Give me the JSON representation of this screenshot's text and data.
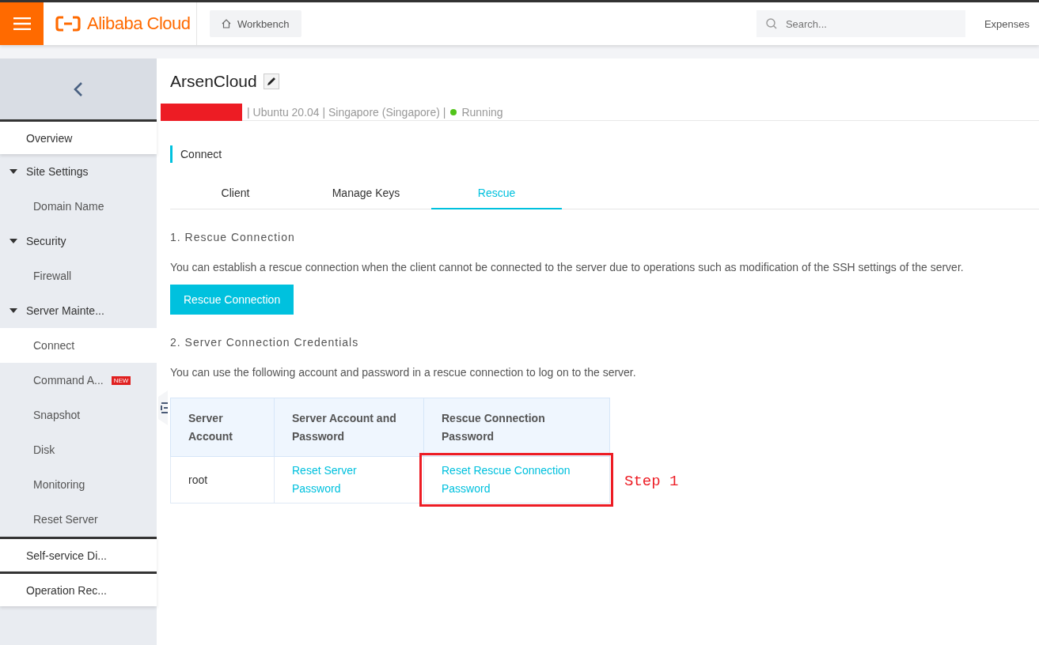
{
  "topbar": {
    "brand": "Alibaba Cloud",
    "workbench": "Workbench",
    "search": {
      "placeholder": "Search..."
    },
    "links": [
      "Expenses"
    ]
  },
  "sidebar": {
    "items": [
      {
        "label": "Overview",
        "kind": "top"
      },
      {
        "label": "Site Settings",
        "kind": "group",
        "expanded": true,
        "selected": false,
        "children": [
          {
            "label": "Domain Name",
            "selected": false
          }
        ]
      },
      {
        "label": "Security",
        "kind": "group",
        "expanded": true,
        "selected": false,
        "children": [
          {
            "label": "Firewall",
            "selected": false
          }
        ]
      },
      {
        "label": "Server Mainte...",
        "kind": "group",
        "expanded": true,
        "selected": false,
        "children": [
          {
            "label": "Connect",
            "selected": true
          },
          {
            "label": "Command A...",
            "selected": false,
            "badge": "NEW"
          },
          {
            "label": "Snapshot",
            "selected": false
          },
          {
            "label": "Disk",
            "selected": false
          },
          {
            "label": "Monitoring",
            "selected": false
          },
          {
            "label": "Reset Server",
            "selected": false
          }
        ]
      },
      {
        "label": "Self-service Di...",
        "kind": "top"
      },
      {
        "label": "Operation Rec...",
        "kind": "top"
      }
    ]
  },
  "header": {
    "title": "ArsenCloud",
    "redacted": true,
    "meta": "| Ubuntu 20.04 | Singapore (Singapore) |",
    "status": {
      "label": "Running",
      "color": "#52c41a"
    }
  },
  "section": {
    "title": "Connect"
  },
  "tabs": [
    {
      "label": "Client",
      "selected": false
    },
    {
      "label": "Manage Keys",
      "selected": false
    },
    {
      "label": "Rescue",
      "selected": true
    }
  ],
  "steps": [
    {
      "heading": "1. Rescue Connection",
      "text": "You can establish a rescue connection when the client cannot be connected to the server due to operations such as modification of the SSH settings of the server.",
      "button": "Rescue Connection"
    },
    {
      "heading": "2. Server Connection Credentials",
      "text": "You can use the following account and password in a rescue connection to log on to the server."
    }
  ],
  "table": {
    "columns": [
      "Server Account",
      "Server Account and Password",
      "Rescue Connection Password"
    ],
    "rows": [
      [
        {
          "text": "root",
          "kind": "text",
          "highlighted": false
        },
        {
          "text": "Reset Server Password",
          "kind": "link",
          "highlighted": false
        },
        {
          "text": "Reset Rescue Connection Password",
          "kind": "link",
          "highlighted": true
        }
      ]
    ]
  },
  "annotation": {
    "label": "Step 1"
  }
}
